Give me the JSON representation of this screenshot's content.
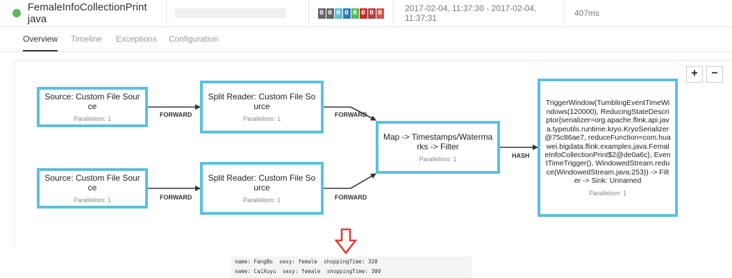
{
  "header": {
    "job_name": "FemaleInfoCollectionPrint java",
    "status_color": "#5cb85c",
    "task_counts": [
      "0",
      "0",
      "0",
      "0",
      "6",
      "0",
      "0",
      "0"
    ],
    "count_colors": [
      "#666666",
      "#666666",
      "#5bc0de",
      "#337ab7",
      "#5cb85c",
      "#c9302c",
      "#a94442",
      "#d9534f"
    ],
    "time_range": "2017-02-04, 11:37:30 - 2017-02-04, 11:37:31",
    "duration": "407ms"
  },
  "tabs": [
    {
      "label": "Overview",
      "active": true
    },
    {
      "label": "Timeline",
      "active": false
    },
    {
      "label": "Exceptions",
      "active": false
    },
    {
      "label": "Configuration",
      "active": false
    }
  ],
  "plan": {
    "zoom_in": "+",
    "zoom_out": "−",
    "nodes": [
      {
        "title": "Source: Custom File Source",
        "parallelism": "Parallelism: 1"
      },
      {
        "title": "Split Reader: Custom File Source",
        "parallelism": "Parallelism: 1"
      },
      {
        "title": "Source: Custom File Source",
        "parallelism": "Parallelism: 1"
      },
      {
        "title": "Split Reader: Custom File Source",
        "parallelism": "Parallelism: 1"
      },
      {
        "title": "Map -> Timestamps/Watermarks -> Filter",
        "parallelism": "Parallelism: 1"
      },
      {
        "title": "TriggerWindow(TumblingEventTimeWindows(120000), ReducingStateDescriptor{serializer=org.apache.flink.api.java.typeutils.runtime.kryo.KryoSerializer@75c86ae7, reduceFunction=com.huawei.bigdata.flink.examples.java.FemaleInfoCollectionPrint$2@de0a6c}, EventTimeTrigger(), WindowedStream.reduce(WindowedStream.java:253)) -> Filter -> Sink: Unnamed",
        "parallelism": "Parallelism: 1"
      }
    ],
    "edges": [
      {
        "label": "FORWARD"
      },
      {
        "label": "FORWARD"
      },
      {
        "label": "FORWARD"
      },
      {
        "label": "FORWARD"
      },
      {
        "label": "HASH"
      }
    ]
  },
  "result_arrow_color": "#e23b3b",
  "console": {
    "lines": [
      "name: FangBo  sexy: female  shoppingTime: 320",
      "name: CaiXuyu  sexy: female  shoppingTime: 300"
    ]
  }
}
